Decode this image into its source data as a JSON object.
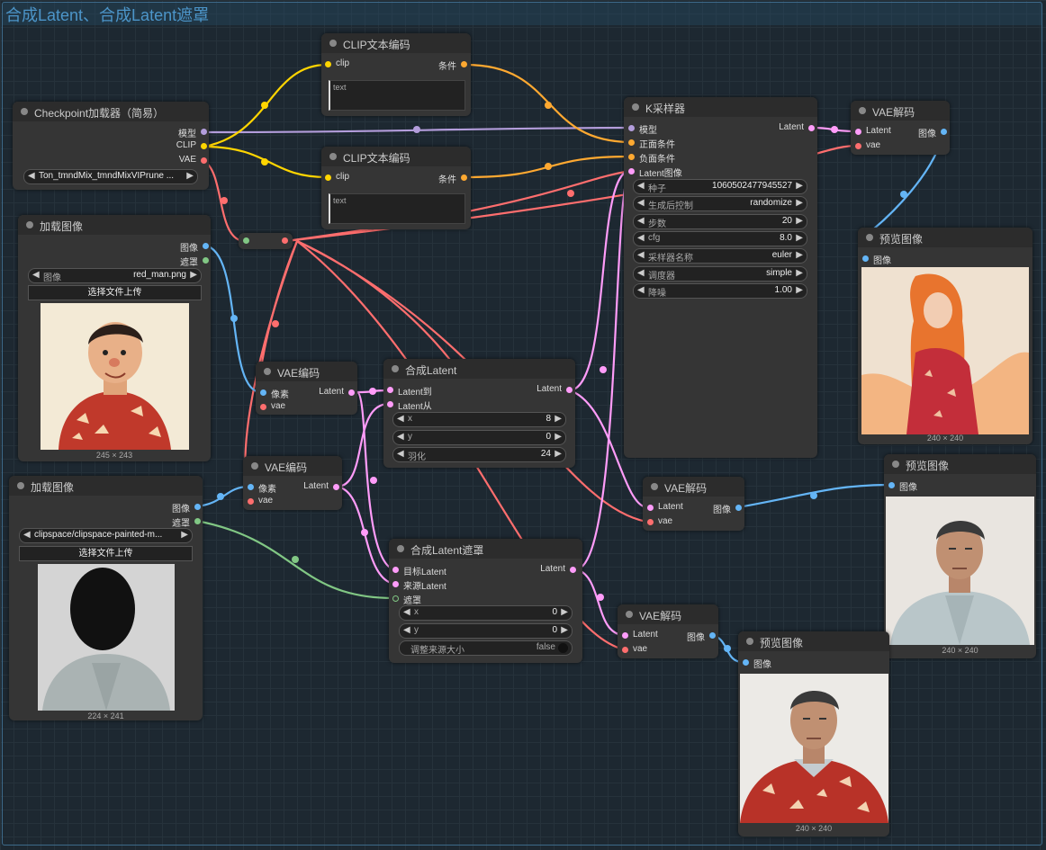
{
  "group_title": "合成Latent、合成Latent遮罩",
  "colors": {
    "model": "#b39ddb",
    "clip": "#ffd500",
    "vae": "#ff6e6e",
    "image": "#64b5f6",
    "mask": "#81c784",
    "latent": "#ff9cf9",
    "cond": "#ffa931"
  },
  "nodes": {
    "clip1": {
      "title": "CLIP文本编码",
      "in": "clip",
      "out": "条件",
      "text": "text"
    },
    "clip2": {
      "title": "CLIP文本编码",
      "in": "clip",
      "out": "条件",
      "text": "text"
    },
    "ckpt": {
      "title": "Checkpoint加载器（简易）",
      "out_model": "模型",
      "out_clip": "CLIP",
      "out_vae": "VAE",
      "ckpt_name": "Ton_tmndMix_tmndMixVIPrune ..."
    },
    "load1": {
      "title": "加载图像",
      "out_image": "图像",
      "out_mask": "遮罩",
      "w_label": "图像",
      "w_value": "red_man.png",
      "upload": "选择文件上传",
      "size": "245 × 243"
    },
    "load2": {
      "title": "加载图像",
      "out_image": "图像",
      "out_mask": "遮罩",
      "w_value": "clipspace/clipspace-painted-m...",
      "upload": "选择文件上传",
      "size": "224 × 241"
    },
    "ksampler": {
      "title": "K采样器",
      "in_model": "模型",
      "in_pos": "正面条件",
      "in_neg": "负面条件",
      "in_latent": "Latent图像",
      "out": "Latent",
      "widgets": [
        {
          "label": "种子",
          "value": "1060502477945527"
        },
        {
          "label": "生成后控制",
          "value": "randomize"
        },
        {
          "label": "步数",
          "value": "20"
        },
        {
          "label": "cfg",
          "value": "8.0"
        },
        {
          "label": "采样器名称",
          "value": "euler"
        },
        {
          "label": "调度器",
          "value": "simple"
        },
        {
          "label": "降噪",
          "value": "1.00"
        }
      ]
    },
    "vaedec1": {
      "title": "VAE解码",
      "in_latent": "Latent",
      "in_vae": "vae",
      "out": "图像"
    },
    "preview1": {
      "title": "预览图像",
      "in": "图像",
      "size": "240 × 240"
    },
    "vaeenc1": {
      "title": "VAE编码",
      "in_pixels": "像素",
      "in_vae": "vae",
      "out": "Latent"
    },
    "vaeenc2": {
      "title": "VAE编码",
      "in_pixels": "像素",
      "in_vae": "vae",
      "out": "Latent"
    },
    "composite": {
      "title": "合成Latent",
      "in_to": "Latent到",
      "in_from": "Latent从",
      "out": "Latent",
      "widgets": [
        {
          "label": "x",
          "value": "8"
        },
        {
          "label": "y",
          "value": "0"
        },
        {
          "label": "羽化",
          "value": "24"
        }
      ]
    },
    "compmask": {
      "title": "合成Latent遮罩",
      "in_dest": "目标Latent",
      "in_src": "来源Latent",
      "in_mask": "遮罩",
      "out": "Latent",
      "widgets": [
        {
          "label": "x",
          "value": "0"
        },
        {
          "label": "y",
          "value": "0"
        }
      ],
      "toggle_label": "调整来源大小",
      "toggle_value": "false"
    },
    "vaedec2": {
      "title": "VAE解码",
      "in_latent": "Latent",
      "in_vae": "vae",
      "out": "图像"
    },
    "preview2": {
      "title": "预览图像",
      "in": "图像",
      "size": "240 × 240"
    },
    "vaedec3": {
      "title": "VAE解码",
      "in_latent": "Latent",
      "in_vae": "vae",
      "out": "图像"
    },
    "preview3": {
      "title": "预览图像",
      "in": "图像",
      "size": "240 × 240"
    }
  }
}
